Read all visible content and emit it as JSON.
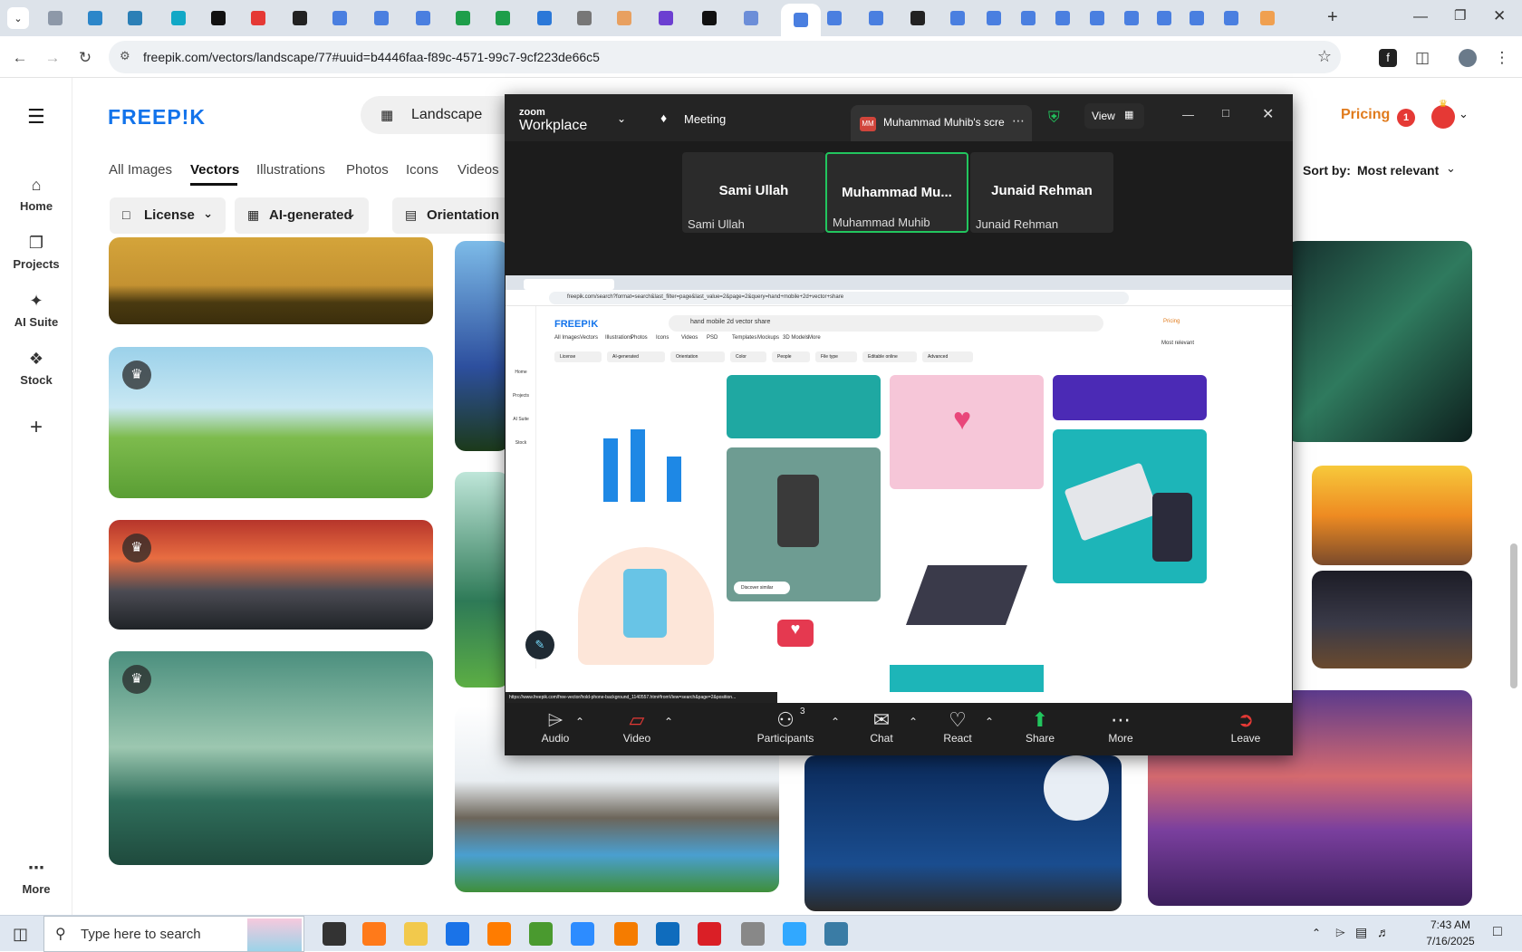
{
  "browser": {
    "url": "freepik.com/vectors/landscape/77#uuid=b4446faa-f89c-4571-99c7-9cf223de66c5",
    "tab_colors": [
      "#8d98a8",
      "#2c86c9",
      "#2b7fb6",
      "#11a8c6",
      "#111111",
      "#e53935",
      "#222222",
      "#4a7fe0",
      "#4a7fe0",
      "#4a7fe0",
      "#1e9e4a",
      "#1e9e4a",
      "#2b78d8",
      "#777777",
      "#e8a060",
      "#6c3fd1",
      "#111111",
      "#6c8ed8",
      "#4a7fe0",
      "#4a7fe0",
      "#4a7fe0",
      "#222222",
      "#4a7fe0",
      "#4a7fe0",
      "#4a7fe0",
      "#4a7fe0",
      "#4a7fe0",
      "#4a7fe0",
      "#4a7fe0",
      "#4a7fe0",
      "#4a7fe0",
      "#f0a050"
    ]
  },
  "freepik": {
    "logo": "FREEP!K",
    "search_value": "Landscape",
    "pricing": "Pricing",
    "notif_count": "1",
    "nav": [
      "Home",
      "Projects",
      "AI Suite",
      "Stock",
      "More"
    ],
    "categories": [
      "All Images",
      "Vectors",
      "Illustrations",
      "Photos",
      "Icons",
      "Videos"
    ],
    "filters": [
      "License",
      "AI-generated",
      "Orientation"
    ],
    "sort_label": "Sort by:",
    "sort_value": "Most relevant"
  },
  "zoom": {
    "brand_top": "zoom",
    "brand_bottom": "Workplace",
    "meeting_label": "Meeting",
    "share_label": "Muhammad Muhib's scre",
    "share_initials": "MM",
    "view_label": "View",
    "participants": [
      {
        "name": "Sami Ullah",
        "label": "Sami Ullah"
      },
      {
        "name": "Muhammad  Mu...",
        "label": "Muhammad Muhib"
      },
      {
        "name": "Junaid Rehman",
        "label": "Junaid Rehman"
      }
    ],
    "participant_count": "3",
    "toolbar": [
      "Audio",
      "Video",
      "Participants",
      "Chat",
      "React",
      "Share",
      "More",
      "Leave"
    ],
    "shared": {
      "url": "freepik.com/search?format=search&last_filter=page&last_value=2&page=2&query=hand+mobile+2d+vector+share",
      "search": "hand mobile 2d vector share",
      "cats": [
        "All Images",
        "Vectors",
        "Illustrations",
        "Photos",
        "Icons",
        "Videos",
        "PSD",
        "Templates",
        "Mockups",
        "3D Models",
        "More"
      ],
      "filters": [
        "License",
        "AI-generated",
        "Orientation",
        "Color",
        "People",
        "File type",
        "Editable online",
        "Advanced"
      ],
      "nav": [
        "Home",
        "Projects",
        "AI Suite",
        "Stock"
      ],
      "discover": "Discover similar",
      "status": "https://www.freepik.com/free-vector/hold-phone-background_1140557.htm#fromView=search&page=2&position..."
    }
  },
  "taskbar": {
    "search_placeholder": "Type here to search",
    "time": "7:43 AM",
    "date": "7/16/2025"
  }
}
